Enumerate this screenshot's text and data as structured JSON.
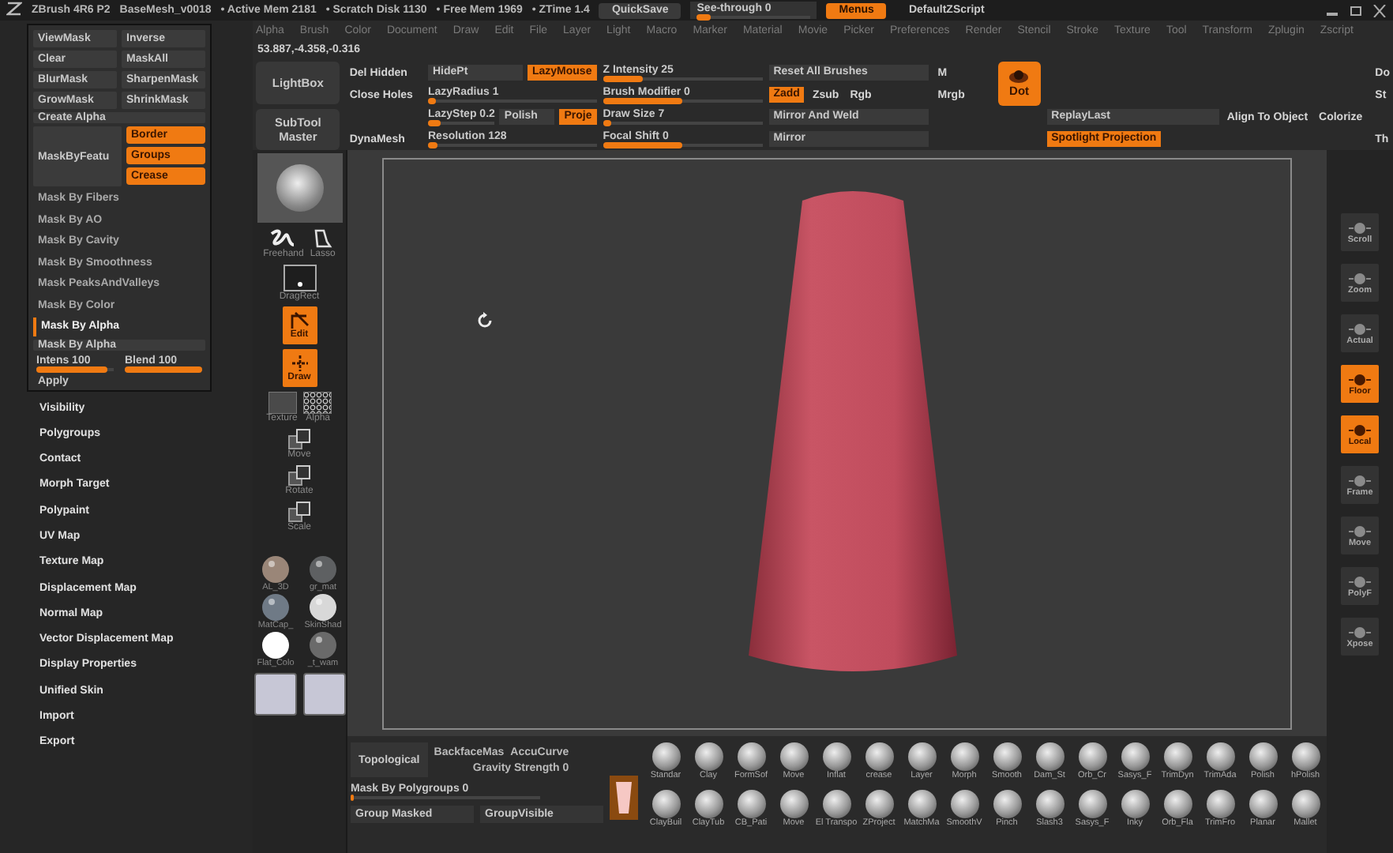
{
  "title_bar": {
    "app": "ZBrush 4R6 P2",
    "file": "BaseMesh_v0018",
    "stats": [
      "• Active Mem 2181",
      "• Scratch Disk 1130",
      "• Free Mem 1969",
      "• ZTime 1.4"
    ],
    "quicksave": "QuickSave",
    "see_through": {
      "label": "See-through  0",
      "level": 0.12
    },
    "menus": {
      "label": "Menus",
      "on": true
    },
    "script": "DefaultZScript"
  },
  "menu_bar": [
    "Alpha",
    "Brush",
    "Color",
    "Document",
    "Draw",
    "Edit",
    "File",
    "Layer",
    "Light",
    "Macro",
    "Marker",
    "Material",
    "Movie",
    "Picker",
    "Preferences",
    "Render",
    "Stencil",
    "Stroke",
    "Texture",
    "Tool",
    "Transform",
    "Zplugin",
    "Zscript"
  ],
  "coordinates": "53.887,-4.358,-0.316",
  "toolbar": [
    {
      "kind": "big",
      "items": [
        {
          "label": "LightBox",
          "on": false
        },
        {
          "label": "SubTool Master",
          "on": false
        }
      ]
    },
    {
      "kind": "stack",
      "rows": [
        [
          {
            "kind": "text",
            "label": "Del Hidden"
          }
        ],
        [
          {
            "kind": "text",
            "label": "Close Holes"
          }
        ],
        [],
        [
          {
            "kind": "text",
            "label": "DynaMesh"
          }
        ]
      ]
    },
    {
      "kind": "stack",
      "rows": [
        [
          {
            "kind": "button",
            "label": "HidePt",
            "on": false
          },
          {
            "kind": "button",
            "label": "LazyMouse",
            "on": true
          }
        ],
        [
          {
            "kind": "slider",
            "label": "LazyRadius 1",
            "level": 0.05
          }
        ],
        [
          {
            "kind": "slider",
            "label": "LazyStep 0.2",
            "level": 0.2
          },
          {
            "kind": "button",
            "label": "Polish",
            "on": false
          },
          {
            "kind": "button",
            "label": "Proje",
            "on": true
          }
        ],
        [
          {
            "kind": "slider",
            "label": "Resolution 128",
            "level": 0.06
          }
        ]
      ]
    },
    {
      "kind": "stack",
      "rows": [
        [
          {
            "kind": "slider",
            "label": "Z Intensity 25",
            "level": 0.25
          }
        ],
        [
          {
            "kind": "slider",
            "label": "Brush Modifier 0",
            "level": 0.5
          }
        ],
        [
          {
            "kind": "slider",
            "label": "Draw Size 7",
            "level": 0.05
          }
        ],
        [
          {
            "kind": "slider",
            "label": "Focal Shift 0",
            "level": 0.5
          }
        ]
      ]
    },
    {
      "kind": "stack",
      "rows": [
        [
          {
            "kind": "button",
            "label": "Reset All Brushes",
            "on": false
          }
        ],
        [
          {
            "kind": "button",
            "label": "Zadd",
            "on": true
          },
          {
            "kind": "text",
            "label": "Zsub"
          },
          {
            "kind": "text",
            "label": "Rgb"
          }
        ],
        [
          {
            "kind": "button",
            "label": "Mirror And Weld",
            "on": false
          }
        ],
        [
          {
            "kind": "button",
            "label": "Mirror",
            "on": false
          }
        ]
      ]
    },
    {
      "kind": "stack",
      "rows": [
        [
          {
            "kind": "text",
            "label": "M"
          }
        ],
        [
          {
            "kind": "text",
            "label": "Mrgb"
          }
        ],
        [],
        []
      ]
    },
    {
      "kind": "big",
      "items": [
        {
          "label": "Dot",
          "on": true
        }
      ]
    },
    {
      "kind": "stack",
      "rows": [
        [],
        [],
        [
          {
            "kind": "button",
            "label": "ReplayLast",
            "on": false
          },
          {
            "kind": "text",
            "label": "Align To Object"
          },
          {
            "kind": "text",
            "label": "Colorize"
          }
        ],
        [
          {
            "kind": "button",
            "label": "Spotlight Projection",
            "on": true
          }
        ]
      ]
    },
    {
      "kind": "stack",
      "rows": [
        [
          {
            "kind": "text",
            "label": "Do"
          }
        ],
        [
          {
            "kind": "text",
            "label": "St"
          }
        ],
        [],
        [
          {
            "kind": "text",
            "label": "Th"
          }
        ]
      ]
    }
  ],
  "mask_panel": {
    "pairs": [
      [
        "ViewMask",
        "Inverse"
      ],
      [
        "Clear",
        "MaskAll"
      ],
      [
        "BlurMask",
        "SharpenMask"
      ],
      [
        "GrowMask",
        "ShrinkMask"
      ]
    ],
    "create_alpha": "Create Alpha",
    "feature": {
      "label": "MaskByFeatu",
      "options": [
        {
          "label": "Border",
          "on": true
        },
        {
          "label": "Groups",
          "on": true
        },
        {
          "label": "Crease",
          "on": true
        }
      ]
    },
    "items": [
      {
        "label": "Mask By Fibers",
        "expanded": false
      },
      {
        "label": "Mask By AO",
        "expanded": false
      },
      {
        "label": "Mask By Cavity",
        "expanded": false
      },
      {
        "label": "Mask By Smoothness",
        "expanded": false
      },
      {
        "label": "Mask PeaksAndValleys",
        "expanded": false
      },
      {
        "label": "Mask By Color",
        "expanded": false
      },
      {
        "label": "Mask By Alpha",
        "expanded": true
      }
    ],
    "alpha_button": "Mask By Alpha",
    "sliders": [
      {
        "label": "Intens 100",
        "level": 0.92
      },
      {
        "label": "Blend 100",
        "level": 1.0
      }
    ],
    "apply": "Apply"
  },
  "subpalettes": [
    "Visibility",
    "Polygroups",
    "Contact",
    "Morph Target",
    "Polypaint",
    "UV Map",
    "Texture Map",
    "Displacement Map",
    "Normal Map",
    "Vector Displacement Map",
    "Display Properties",
    "Unified Skin",
    "Import",
    "Export"
  ],
  "tool_shelf": {
    "strokes": [
      {
        "label": "Freehand",
        "kind": "freehand"
      },
      {
        "label": "Lasso",
        "kind": "lasso"
      }
    ],
    "drag": {
      "label": "DragRect"
    },
    "modes": [
      {
        "label": "Edit",
        "on": true,
        "kind": "edit"
      },
      {
        "label": "Draw",
        "on": true,
        "kind": "draw"
      }
    ],
    "textures": [
      "Texture",
      "Alpha"
    ],
    "transforms": [
      "Move",
      "Rotate",
      "Scale"
    ],
    "materials": [
      {
        "label": "AL_3D",
        "color": "#9a8678"
      },
      {
        "label": "gr_mat",
        "color": "#5e6062"
      },
      {
        "label": "MatCap_",
        "color": "#6f7a86"
      },
      {
        "label": "SkinShad",
        "color": "#d8d8d8"
      },
      {
        "label": "Flat_Colo",
        "color": "#ffffff"
      },
      {
        "label": "_t_wam",
        "color": "#6a6a6a"
      }
    ]
  },
  "right_shelf": [
    {
      "label": "Scroll",
      "on": false
    },
    {
      "label": "Zoom",
      "on": false
    },
    {
      "label": "Actual",
      "on": false
    },
    {
      "label": "Floor",
      "on": true
    },
    {
      "label": "Local",
      "on": true
    },
    {
      "label": "Frame",
      "on": false
    },
    {
      "label": "Move",
      "on": false
    },
    {
      "label": "PolyF",
      "on": false
    },
    {
      "label": "Xpose",
      "on": false
    }
  ],
  "bottom_bar": {
    "topological": "Topological",
    "backface": "BackfaceMas",
    "accucurve": "AccuCurve",
    "gravity": "Gravity Strength 0",
    "polygroups": {
      "label": "Mask By Polygroups 0",
      "level": 0.02
    },
    "group_masked": "Group Masked",
    "group_visible": "GroupVisible",
    "brushes_top": [
      "Standar",
      "Clay",
      "FormSof",
      "Move",
      "Inflat",
      "crease",
      "Layer",
      "Morph",
      "Smooth",
      "Dam_St",
      "Orb_Cr",
      "Sasys_F",
      "TrimDyn",
      "TrimAda",
      "Polish",
      "hPolish"
    ],
    "brushes_bottom": [
      "ClayBuil",
      "ClayTub",
      "CB_Pati",
      "Move",
      "El Transpo",
      "ZProject",
      "MatchMa",
      "SmoothV",
      "Pinch",
      "Slash3",
      "Sasys_F",
      "Inky",
      "Orb_Fla",
      "TrimFro",
      "Planar",
      "Mallet"
    ]
  }
}
